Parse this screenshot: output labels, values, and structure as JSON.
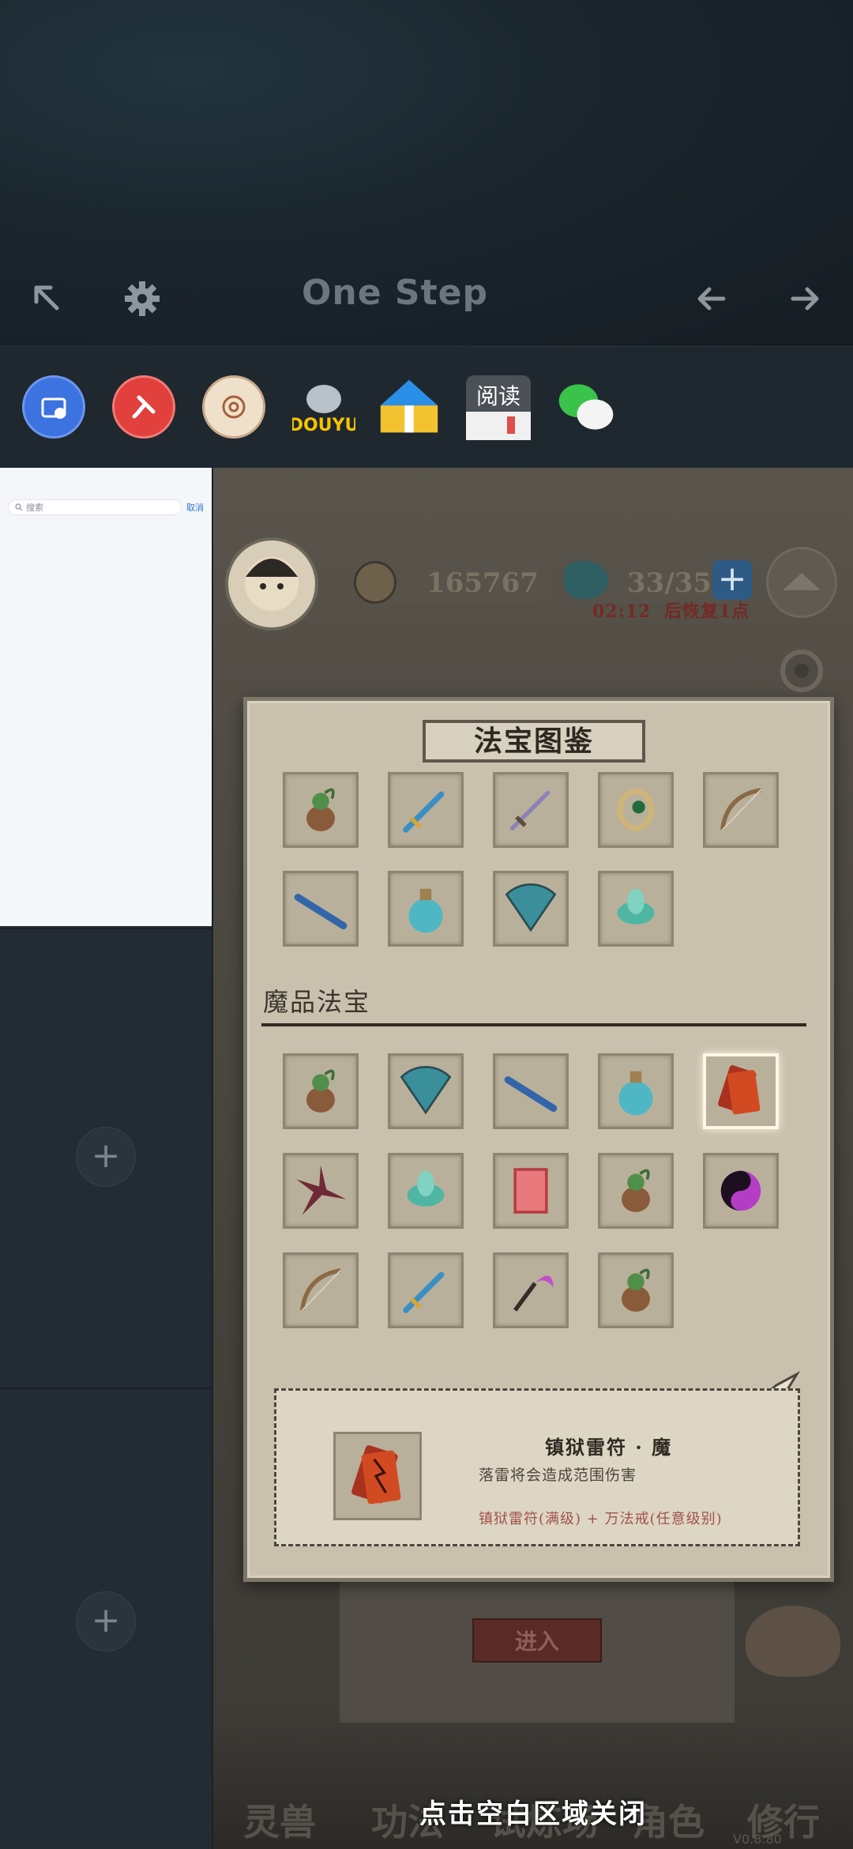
{
  "header": {
    "title": "One Step",
    "icons": [
      "arrow-up-left-icon",
      "gear-icon",
      "arrow-left-icon",
      "arrow-right-icon"
    ]
  },
  "apps": [
    {
      "name": "file-manager-app-icon",
      "color": "#3d73e0"
    },
    {
      "name": "pin-app-icon",
      "color": "#e2403c"
    },
    {
      "name": "at-app-icon",
      "color": "#e8d5bf"
    },
    {
      "name": "douyu-app-icon",
      "color": "#f5c400"
    },
    {
      "name": "maps-app-icon",
      "color": "#2a8fe8"
    },
    {
      "name": "reader-app-icon",
      "color": "#5b5f66"
    },
    {
      "name": "wechat-app-icon",
      "color": "#39c34a"
    }
  ],
  "side": {
    "search_placeholder": "搜索",
    "cancel": "取消"
  },
  "game": {
    "coins": "165767",
    "energy": "33/35",
    "timer": "02:12",
    "timer_suffix": "后恢复1点",
    "enter": "进入",
    "version": "V0.8.80"
  },
  "encyclopedia": {
    "title": "法宝图鉴",
    "section_demon": "魔品法宝",
    "normal_items": [
      "gourd-icon",
      "sword-icon",
      "blade-icon",
      "ring-icon",
      "bow-icon",
      "flute-icon",
      "potion-icon",
      "fan-icon",
      "lotus-icon"
    ],
    "demon_items": [
      "gourd-icon",
      "fan-icon",
      "flute-icon",
      "potion-icon",
      "thunder-talisman-icon",
      "shuriken-icon",
      "lotus-icon",
      "talisman-icon",
      "gourd-icon",
      "taiji-icon",
      "bow-icon",
      "sword-icon",
      "sickle-icon",
      "gourd-icon"
    ],
    "selected_index": 4,
    "detail": {
      "name": "镇狱雷符 · 魔",
      "desc": "落雷将会造成范围伤害",
      "recipe": "镇狱雷符(满级) + 万法戒(任意级别)"
    }
  },
  "bottom_nav": [
    "灵兽",
    "功法",
    "试炼场",
    "角色",
    "修行"
  ],
  "close_hint": "点击空白区域关闭"
}
